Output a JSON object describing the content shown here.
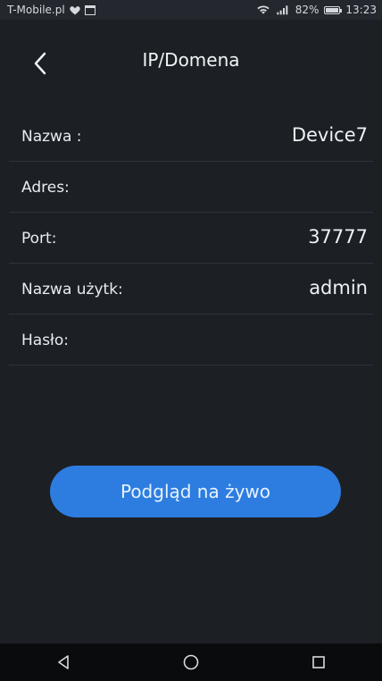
{
  "status_bar": {
    "carrier": "T-Mobile.pl",
    "battery": "82%",
    "time": "13:23",
    "icons": [
      "heart-icon",
      "calendar-icon",
      "wifi-icon",
      "signal-icon",
      "battery-icon"
    ]
  },
  "header": {
    "title": "IP/Domena",
    "back_icon": "chevron-left-icon"
  },
  "fields": [
    {
      "label": "Nazwa :",
      "value": "Device7"
    },
    {
      "label": "Adres:",
      "value": ""
    },
    {
      "label": "Port:",
      "value": "37777"
    },
    {
      "label": "Nazwa użytk:",
      "value": "admin"
    },
    {
      "label": "Hasło:",
      "value": ""
    }
  ],
  "primary_button": {
    "label": "Podgląd na żywo"
  },
  "colors": {
    "background": "#1c1f24",
    "accent": "#2d7de0",
    "navbar": "#0a0b0d"
  },
  "navbar": {
    "icons": [
      "back-triangle-icon",
      "home-circle-icon",
      "recents-square-icon"
    ]
  }
}
